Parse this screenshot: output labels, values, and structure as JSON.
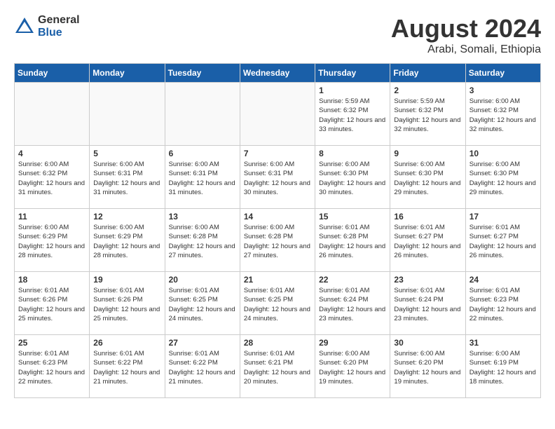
{
  "header": {
    "logo": {
      "general": "General",
      "blue": "Blue"
    },
    "title": "August 2024",
    "subtitle": "Arabi, Somali, Ethiopia"
  },
  "weekdays": [
    "Sunday",
    "Monday",
    "Tuesday",
    "Wednesday",
    "Thursday",
    "Friday",
    "Saturday"
  ],
  "weeks": [
    [
      {
        "day": "",
        "info": ""
      },
      {
        "day": "",
        "info": ""
      },
      {
        "day": "",
        "info": ""
      },
      {
        "day": "",
        "info": ""
      },
      {
        "day": "1",
        "info": "Sunrise: 5:59 AM\nSunset: 6:32 PM\nDaylight: 12 hours\nand 33 minutes."
      },
      {
        "day": "2",
        "info": "Sunrise: 5:59 AM\nSunset: 6:32 PM\nDaylight: 12 hours\nand 32 minutes."
      },
      {
        "day": "3",
        "info": "Sunrise: 6:00 AM\nSunset: 6:32 PM\nDaylight: 12 hours\nand 32 minutes."
      }
    ],
    [
      {
        "day": "4",
        "info": "Sunrise: 6:00 AM\nSunset: 6:32 PM\nDaylight: 12 hours\nand 31 minutes."
      },
      {
        "day": "5",
        "info": "Sunrise: 6:00 AM\nSunset: 6:31 PM\nDaylight: 12 hours\nand 31 minutes."
      },
      {
        "day": "6",
        "info": "Sunrise: 6:00 AM\nSunset: 6:31 PM\nDaylight: 12 hours\nand 31 minutes."
      },
      {
        "day": "7",
        "info": "Sunrise: 6:00 AM\nSunset: 6:31 PM\nDaylight: 12 hours\nand 30 minutes."
      },
      {
        "day": "8",
        "info": "Sunrise: 6:00 AM\nSunset: 6:30 PM\nDaylight: 12 hours\nand 30 minutes."
      },
      {
        "day": "9",
        "info": "Sunrise: 6:00 AM\nSunset: 6:30 PM\nDaylight: 12 hours\nand 29 minutes."
      },
      {
        "day": "10",
        "info": "Sunrise: 6:00 AM\nSunset: 6:30 PM\nDaylight: 12 hours\nand 29 minutes."
      }
    ],
    [
      {
        "day": "11",
        "info": "Sunrise: 6:00 AM\nSunset: 6:29 PM\nDaylight: 12 hours\nand 28 minutes."
      },
      {
        "day": "12",
        "info": "Sunrise: 6:00 AM\nSunset: 6:29 PM\nDaylight: 12 hours\nand 28 minutes."
      },
      {
        "day": "13",
        "info": "Sunrise: 6:00 AM\nSunset: 6:28 PM\nDaylight: 12 hours\nand 27 minutes."
      },
      {
        "day": "14",
        "info": "Sunrise: 6:00 AM\nSunset: 6:28 PM\nDaylight: 12 hours\nand 27 minutes."
      },
      {
        "day": "15",
        "info": "Sunrise: 6:01 AM\nSunset: 6:28 PM\nDaylight: 12 hours\nand 26 minutes."
      },
      {
        "day": "16",
        "info": "Sunrise: 6:01 AM\nSunset: 6:27 PM\nDaylight: 12 hours\nand 26 minutes."
      },
      {
        "day": "17",
        "info": "Sunrise: 6:01 AM\nSunset: 6:27 PM\nDaylight: 12 hours\nand 26 minutes."
      }
    ],
    [
      {
        "day": "18",
        "info": "Sunrise: 6:01 AM\nSunset: 6:26 PM\nDaylight: 12 hours\nand 25 minutes."
      },
      {
        "day": "19",
        "info": "Sunrise: 6:01 AM\nSunset: 6:26 PM\nDaylight: 12 hours\nand 25 minutes."
      },
      {
        "day": "20",
        "info": "Sunrise: 6:01 AM\nSunset: 6:25 PM\nDaylight: 12 hours\nand 24 minutes."
      },
      {
        "day": "21",
        "info": "Sunrise: 6:01 AM\nSunset: 6:25 PM\nDaylight: 12 hours\nand 24 minutes."
      },
      {
        "day": "22",
        "info": "Sunrise: 6:01 AM\nSunset: 6:24 PM\nDaylight: 12 hours\nand 23 minutes."
      },
      {
        "day": "23",
        "info": "Sunrise: 6:01 AM\nSunset: 6:24 PM\nDaylight: 12 hours\nand 23 minutes."
      },
      {
        "day": "24",
        "info": "Sunrise: 6:01 AM\nSunset: 6:23 PM\nDaylight: 12 hours\nand 22 minutes."
      }
    ],
    [
      {
        "day": "25",
        "info": "Sunrise: 6:01 AM\nSunset: 6:23 PM\nDaylight: 12 hours\nand 22 minutes."
      },
      {
        "day": "26",
        "info": "Sunrise: 6:01 AM\nSunset: 6:22 PM\nDaylight: 12 hours\nand 21 minutes."
      },
      {
        "day": "27",
        "info": "Sunrise: 6:01 AM\nSunset: 6:22 PM\nDaylight: 12 hours\nand 21 minutes."
      },
      {
        "day": "28",
        "info": "Sunrise: 6:01 AM\nSunset: 6:21 PM\nDaylight: 12 hours\nand 20 minutes."
      },
      {
        "day": "29",
        "info": "Sunrise: 6:00 AM\nSunset: 6:20 PM\nDaylight: 12 hours\nand 19 minutes."
      },
      {
        "day": "30",
        "info": "Sunrise: 6:00 AM\nSunset: 6:20 PM\nDaylight: 12 hours\nand 19 minutes."
      },
      {
        "day": "31",
        "info": "Sunrise: 6:00 AM\nSunset: 6:19 PM\nDaylight: 12 hours\nand 18 minutes."
      }
    ]
  ]
}
